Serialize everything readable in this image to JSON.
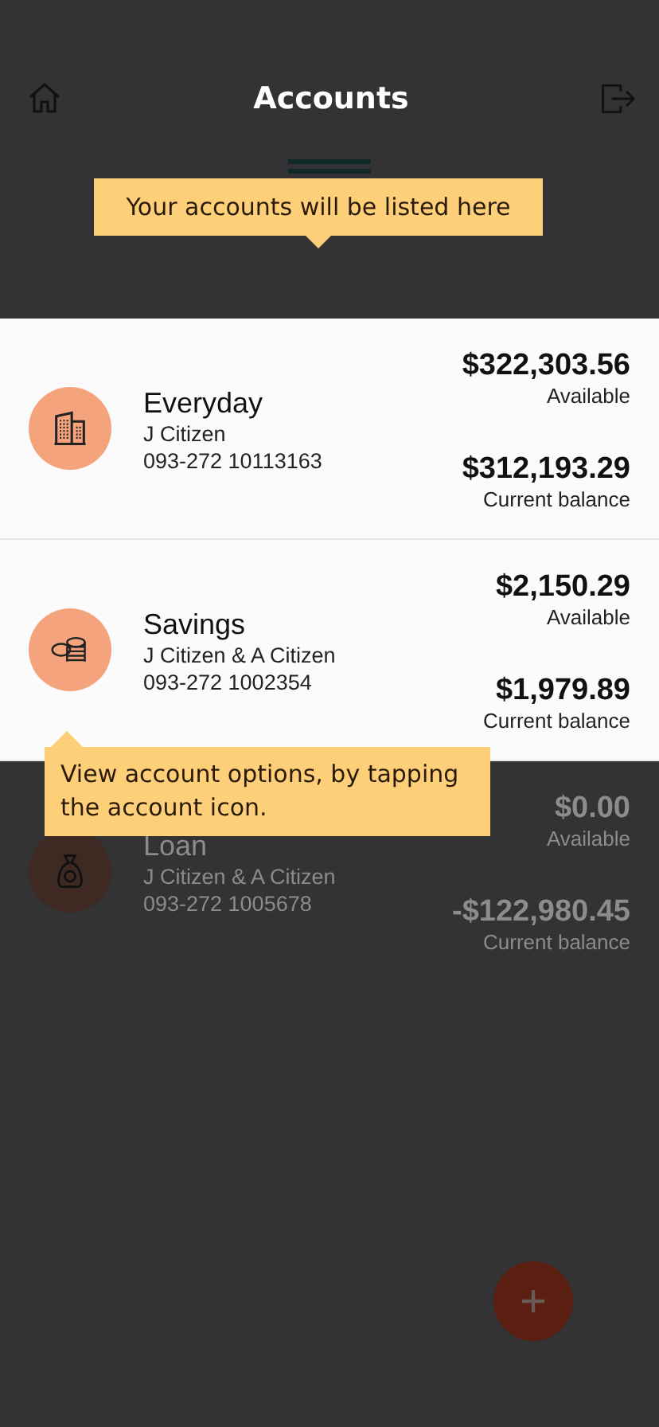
{
  "header": {
    "title": "Accounts"
  },
  "hints": [
    {
      "text": "Your accounts will be listed here"
    },
    {
      "text": "View account options, by tapping the account icon."
    }
  ],
  "accounts": [
    {
      "kind": "everyday",
      "name": "Everyday",
      "owner": "J Citizen",
      "number": "093-272 10113163",
      "available": "$322,303.56",
      "available_label": "Available",
      "balance": "$312,193.29",
      "balance_label": "Current balance",
      "highlighted": true
    },
    {
      "kind": "savings",
      "name": "Savings",
      "owner": "J Citizen & A Citizen",
      "number": "093-272 1002354",
      "available": "$2,150.29",
      "available_label": "Available",
      "balance": "$1,979.89",
      "balance_label": "Current balance",
      "highlighted": true
    },
    {
      "kind": "loan",
      "name": "Loan",
      "owner": "J Citizen & A Citizen",
      "number": "093-272 1005678",
      "available": "$0.00",
      "available_label": "Available",
      "balance": "-$122,980.45",
      "balance_label": "Current balance",
      "highlighted": false
    }
  ]
}
